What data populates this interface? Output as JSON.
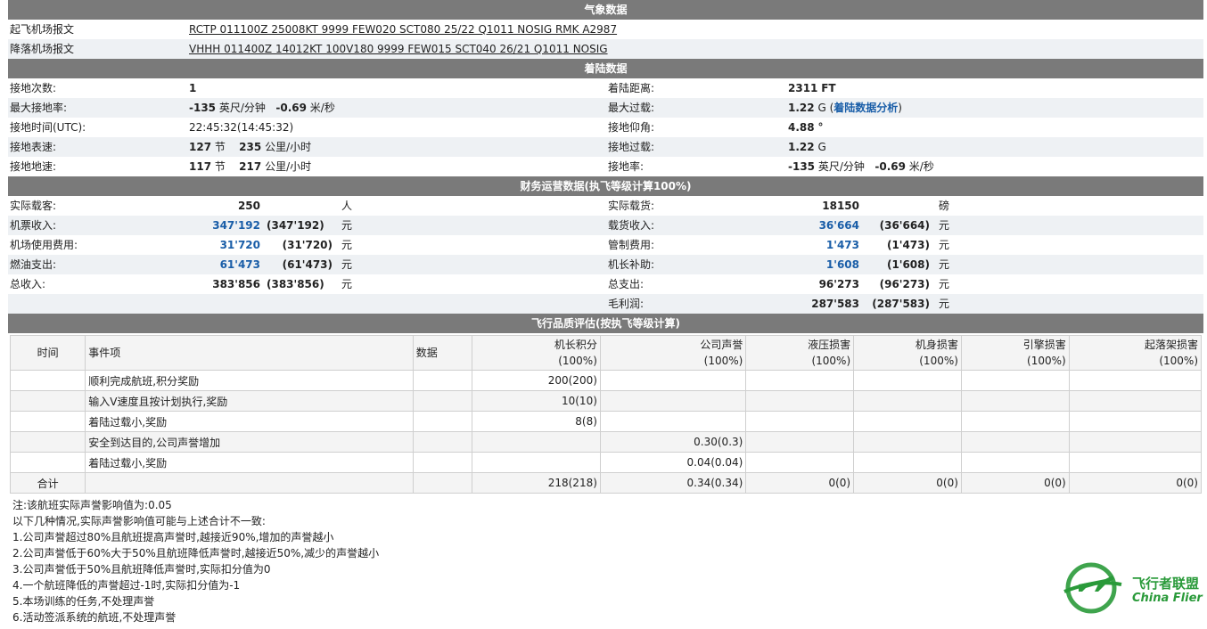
{
  "weather": {
    "title": "气象数据",
    "dep_label": "起飞机场报文",
    "dep_metar": "RCTP 011100Z 25008KT 9999 FEW020 SCT080 25/22 Q1011 NOSIG RMK A2987",
    "arr_label": "降落机场报文",
    "arr_metar": "VHHH 011400Z 14012KT 100V180 9999 FEW015 SCT040 26/21 Q1011 NOSIG"
  },
  "landing": {
    "title": "着陆数据",
    "touchdowns_label": "接地次数:",
    "touchdowns": "1",
    "distance_label": "着陆距离:",
    "distance_value": "2311",
    "distance_unit": "FT",
    "max_rate_label": "最大接地率:",
    "max_rate_fpm": "-135",
    "fpm_unit": "英尺/分钟",
    "max_rate_ms": "-0.69",
    "ms_unit": "米/秒",
    "max_g_label": "最大过载:",
    "max_g": "1.22",
    "g_unit": "G",
    "analysis_link": "着陆数据分析",
    "time_label": "接地时间(UTC):",
    "time_value": "22:45:32(14:45:32)",
    "pitch_label": "接地仰角:",
    "pitch_value": "4.88",
    "pitch_unit": "°",
    "ias_label": "接地表速:",
    "ias_kt": "127",
    "kt_unit": "节",
    "ias_kmh": "235",
    "kmh_unit": "公里/小时",
    "td_g_label": "接地过载:",
    "td_g": "1.22",
    "gs_label": "接地地速:",
    "gs_kt": "117",
    "gs_kmh": "217",
    "td_rate_label": "接地率:",
    "td_rate_fpm": "-135",
    "td_rate_ms": "-0.69"
  },
  "finance": {
    "title": "财务运营数据(执飞等级计算100%)",
    "pax_label": "实际载客:",
    "pax_value": "250",
    "pax_unit": "人",
    "cargo_label": "实际载货:",
    "cargo_value": "18150",
    "cargo_unit": "磅",
    "ticket_label": "机票收入:",
    "ticket_value": "347'192",
    "ticket_paren": "(347'192)",
    "cargo_rev_label": "载货收入:",
    "cargo_rev_value": "36'664",
    "cargo_rev_paren": "(36'664)",
    "airport_label": "机场使用费用:",
    "airport_value": "31'720",
    "airport_paren": "(31'720)",
    "atc_label": "管制费用:",
    "atc_value": "1'473",
    "atc_paren": "(1'473)",
    "fuel_label": "燃油支出:",
    "fuel_value": "61'473",
    "fuel_paren": "(61'473)",
    "captain_label": "机长补助:",
    "captain_value": "1'608",
    "captain_paren": "(1'608)",
    "income_label": "总收入:",
    "income_value": "383'856",
    "income_paren": "(383'856)",
    "expense_label": "总支出:",
    "expense_value": "96'273",
    "expense_paren": "(96'273)",
    "profit_label": "毛利润:",
    "profit_value": "287'583",
    "profit_paren": "(287'583)",
    "currency": "元"
  },
  "quality": {
    "title": "飞行品质评估(按执飞等级计算)",
    "headers": {
      "time": "时间",
      "event": "事件项",
      "data": "数据",
      "score": "机长积分",
      "reputation": "公司声誉",
      "hydraulic": "液压损害",
      "airframe": "机身损害",
      "engine": "引擎损害",
      "gear": "起落架损害",
      "pct": "(100%)"
    },
    "rows": [
      {
        "event": "顺利完成航班,积分奖励",
        "score": "200(200)",
        "reputation": ""
      },
      {
        "event": "输入V速度且按计划执行,奖励",
        "score": "10(10)",
        "reputation": ""
      },
      {
        "event": "着陆过载小,奖励",
        "score": "8(8)",
        "reputation": ""
      },
      {
        "event": "安全到达目的,公司声誉增加",
        "score": "",
        "reputation": "0.30(0.3)"
      },
      {
        "event": "着陆过载小,奖励",
        "score": "",
        "reputation": "0.04(0.04)"
      }
    ],
    "total": {
      "label": "合计",
      "score": "218(218)",
      "reputation": "0.34(0.34)",
      "hydraulic": "0(0)",
      "airframe": "0(0)",
      "engine": "0(0)",
      "gear": "0(0)"
    }
  },
  "notes": {
    "lines": [
      "注:该航班实际声誉影响值为:0.05",
      "以下几种情况,实际声誉影响值可能与上述合计不一致:",
      "1.公司声誉超过80%且航班提高声誉时,越接近90%,增加的声誉越小",
      "2.公司声誉低于60%大于50%且航班降低声誉时,越接近50%,减少的声誉越小",
      "3.公司声誉低于50%且航班降低声誉时,实际扣分值为0",
      "4.一个航班降低的声誉超过-1时,实际扣分值为-1",
      "5.本场训练的任务,不处理声誉",
      "6.活动签派系统的航班,不处理声誉"
    ]
  },
  "logo": {
    "cn": "飞行者联盟",
    "en": "China Flier",
    "color": "#2a9a3a"
  }
}
